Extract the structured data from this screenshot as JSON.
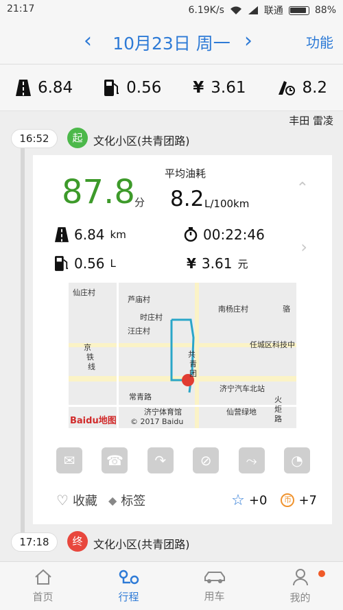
{
  "status_bar": {
    "time": "21:17",
    "speed": "6.19K/s",
    "carrier": "联通",
    "battery": "88%"
  },
  "header": {
    "date": "10月23日 周一",
    "menu": "功能"
  },
  "stats": [
    {
      "icon": "road-icon",
      "value": "6.84"
    },
    {
      "icon": "fuel-icon",
      "value": "0.56"
    },
    {
      "icon": "yen-icon",
      "value": "3.61"
    },
    {
      "icon": "fuel-consumption-icon",
      "value": "8.2"
    }
  ],
  "car_name": "丰田 雷凌",
  "trip": {
    "start_time": "16:52",
    "start_badge": "起",
    "start_location": "文化小区(共青团路)",
    "end_time": "17:18",
    "end_badge": "终",
    "end_location": "文化小区(共青团路)",
    "score": "87.8",
    "score_unit": "分",
    "avg_label": "平均油耗",
    "avg_value": "8.2",
    "avg_unit": "L/100km",
    "distance": "6.84",
    "distance_unit": "km",
    "duration": "00:22:46",
    "fuel": "0.56",
    "fuel_unit": "L",
    "cost": "3.61",
    "cost_unit": "元"
  },
  "map": {
    "labels": [
      "仙庄村",
      "芦庙村",
      "南杨庄村",
      "骆",
      "时庄村",
      "汪庄村",
      "任城区科技中",
      "京",
      "铁",
      "线",
      "共",
      "青",
      "团",
      "济宁汽车北站",
      "常青路",
      "济宁体育馆",
      "仙营绿地",
      "火",
      "炬",
      "路",
      "© 2017 Baidu"
    ],
    "logo": "Baidu地图"
  },
  "actions": [
    "mail-icon",
    "phone-icon",
    "share-icon",
    "no-phone-icon",
    "curve-icon",
    "speedometer-icon"
  ],
  "bottom": {
    "favorite": "收藏",
    "tag": "标签",
    "star_count": "+0",
    "coin_count": "+7"
  },
  "tabs": [
    {
      "label": "首页",
      "icon": "home-icon"
    },
    {
      "label": "行程",
      "icon": "route-icon"
    },
    {
      "label": "用车",
      "icon": "car-icon"
    },
    {
      "label": "我的",
      "icon": "user-icon"
    }
  ],
  "colors": {
    "accent": "#2d7ad6",
    "score": "#3d9a2a",
    "end_badge": "#e8473d",
    "start_badge": "#4cb84a",
    "coin": "#f0932e"
  }
}
